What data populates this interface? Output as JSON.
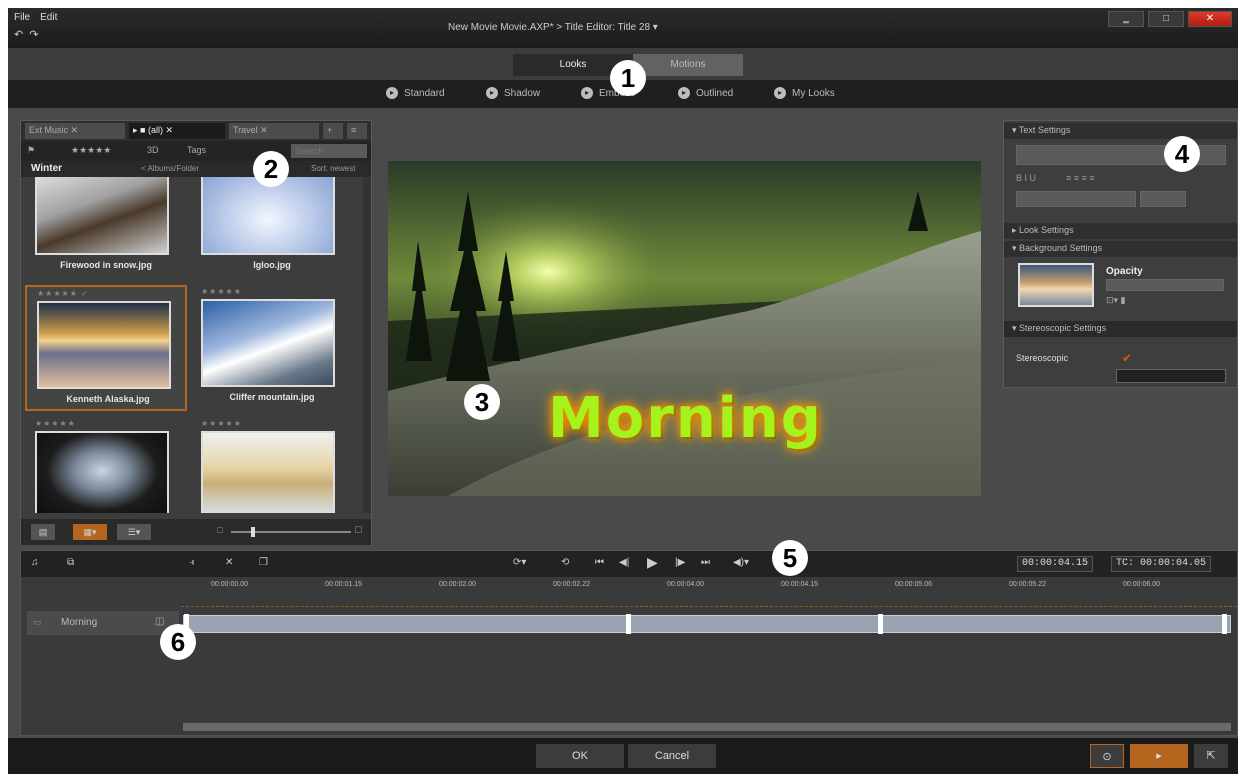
{
  "menu": [
    "File",
    "Edit"
  ],
  "window_title": "New Movie Movie.AXP*  >  Title Editor: Title 28  ▾",
  "mode_tabs": {
    "looks": "Looks",
    "motions": "Motions"
  },
  "looks_categories": [
    "Standard",
    "Shadow",
    "Emboss",
    "Outlined",
    "My Looks"
  ],
  "library": {
    "tabs": [
      "Ext Music",
      "(all)",
      "Travel"
    ],
    "filter": {
      "stars": "★★★★★",
      "mode": "3D",
      "tags": "Tags"
    },
    "search_placeholder": "Search",
    "folder": "Winter",
    "path": "< Albums/Folder",
    "sort": "Sort: newest",
    "thumbnails": [
      {
        "caption": "Firewood in snow.jpg",
        "stars": ""
      },
      {
        "caption": "Igloo.jpg",
        "stars": ""
      },
      {
        "caption": "Kenneth Alaska.jpg",
        "stars": "★★★★★ ✓"
      },
      {
        "caption": "Cliffer mountain.jpg",
        "stars": "★★★★★"
      },
      {
        "caption": "",
        "stars": "★★★★★"
      },
      {
        "caption": "",
        "stars": "★★★★★"
      }
    ]
  },
  "preview": {
    "title_text": "Morning"
  },
  "settings": {
    "text_settings": "Text Settings",
    "look_settings": "Look Settings",
    "background_settings": "Background Settings",
    "opacity_label": "Opacity",
    "stereo_settings": "Stereoscopic Settings",
    "stereo_label": "Stereoscopic"
  },
  "timeline": {
    "timecode_duration": "00:00:04.15",
    "timecode_current": "TC: 00:00:04.05",
    "ticks": [
      "00:00:00.00",
      "00:00:01.15",
      "00:00:02.00",
      "00:00:02.22",
      "00:00:04.00",
      "00:00:04.15",
      "00:00:05.06",
      "00:00:05.22",
      "00:00:06.00"
    ],
    "track_name": "Morning"
  },
  "bottom": {
    "ok": "OK",
    "cancel": "Cancel"
  },
  "callouts": [
    "1",
    "2",
    "3",
    "4",
    "5",
    "6"
  ],
  "colors": {
    "accent_orange": "#b5651d",
    "title_green": "#a6f21c",
    "close_red": "#d02a1a"
  }
}
